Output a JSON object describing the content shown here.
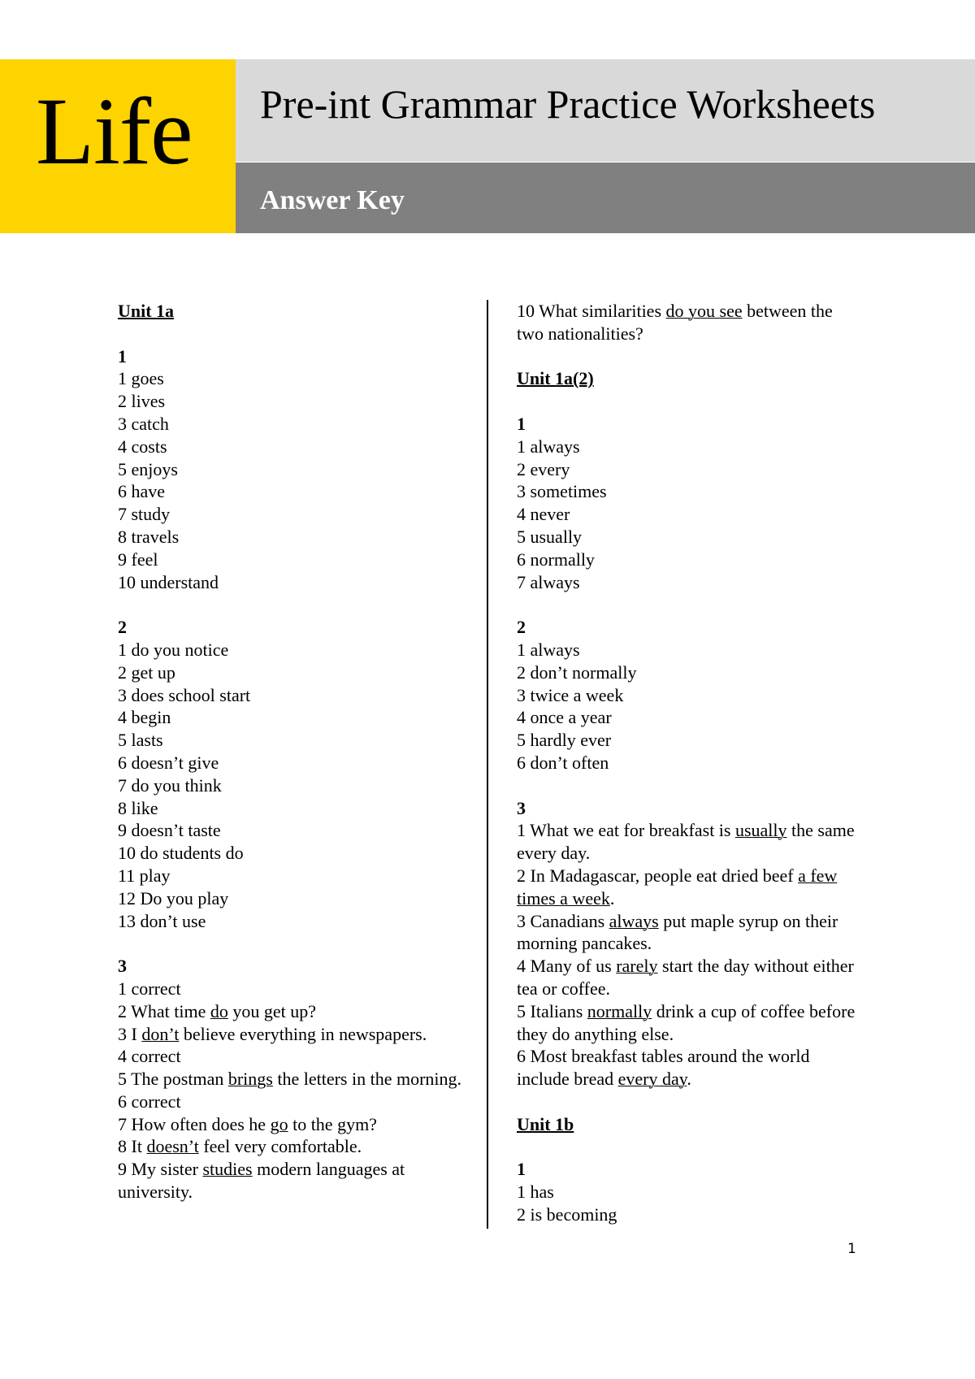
{
  "header": {
    "logo": "Life",
    "title": "Pre-int Grammar Practice Worksheets",
    "subtitle": "Answer Key",
    "colors": {
      "logo_bg": "#FDD300",
      "title_bg": "#D9D9D9",
      "subtitle_bg": "#808080"
    }
  },
  "left_column": {
    "unit_heading": "Unit 1a",
    "exercises": [
      {
        "number": "1",
        "answers": [
          "1 goes",
          "2 lives",
          "3 catch",
          "4 costs",
          "5 enjoys",
          "6 have",
          "7 study",
          "8 travels",
          "9 feel",
          "10 understand"
        ]
      },
      {
        "number": "2",
        "answers": [
          "1 do you notice",
          "2 get up",
          "3 does school start",
          "4 begin",
          "5 lasts",
          "6 doesn’t give",
          "7 do you think",
          "8 like",
          "9 doesn’t taste",
          "10 do students do",
          "11 play",
          "12 Do you play",
          "13 don’t use"
        ]
      },
      {
        "number": "3",
        "answers": [
          {
            "before": "1 correct",
            "underlined": "",
            "after": ""
          },
          {
            "before": "2 What time ",
            "underlined": "do",
            "after": " you get up?"
          },
          {
            "before": "3 I ",
            "underlined": "don’t",
            "after": " believe everything in newspapers."
          },
          {
            "before": "4 correct",
            "underlined": "",
            "after": ""
          },
          {
            "before": "5 The postman ",
            "underlined": "brings",
            "after": " the letters in the morning."
          },
          {
            "before": "6 correct",
            "underlined": "",
            "after": ""
          },
          {
            "before": "7 How often does he ",
            "underlined": "go",
            "after": " to the gym?"
          },
          {
            "before": "8 It ",
            "underlined": "doesn’t",
            "after": " feel very comfortable."
          },
          {
            "before": "9 My sister ",
            "underlined": "studies",
            "after": " modern languages at university."
          }
        ]
      }
    ]
  },
  "right_column": {
    "continuation": {
      "before": "10 What similarities ",
      "underlined": "do you see",
      "after": " between the two nationalities?"
    },
    "unit_1a2": {
      "heading": "Unit 1a(2)",
      "exercises": [
        {
          "number": "1",
          "answers": [
            "1 always",
            "2 every",
            "3 sometimes",
            "4 never",
            "5 usually",
            "6 normally",
            "7 always"
          ]
        },
        {
          "number": "2",
          "answers": [
            "1 always",
            "2 don’t normally",
            "3 twice a week",
            "4 once a year",
            "5 hardly ever",
            "6 don’t often"
          ]
        },
        {
          "number": "3",
          "answers": [
            {
              "before": "1 What we eat for breakfast is ",
              "underlined": "usually",
              "after": " the same every day."
            },
            {
              "before": "2 In Madagascar, people eat dried beef ",
              "underlined": "a few times a week",
              "after": "."
            },
            {
              "before": "3 Canadians ",
              "underlined": "always",
              "after": " put maple syrup on their morning pancakes."
            },
            {
              "before": "4 Many of us ",
              "underlined": "rarely",
              "after": " start the day without either tea or coffee."
            },
            {
              "before": "5 Italians ",
              "underlined": "normally",
              "after": " drink a cup of coffee before they do anything else."
            },
            {
              "before": "6 Most breakfast tables around the world include bread ",
              "underlined": "every day",
              "after": "."
            }
          ]
        }
      ]
    },
    "unit_1b": {
      "heading": "Unit 1b",
      "exercises": [
        {
          "number": "1",
          "answers": [
            "1 has",
            "2 is becoming"
          ]
        }
      ]
    }
  },
  "footer": {
    "page_number": "1"
  }
}
